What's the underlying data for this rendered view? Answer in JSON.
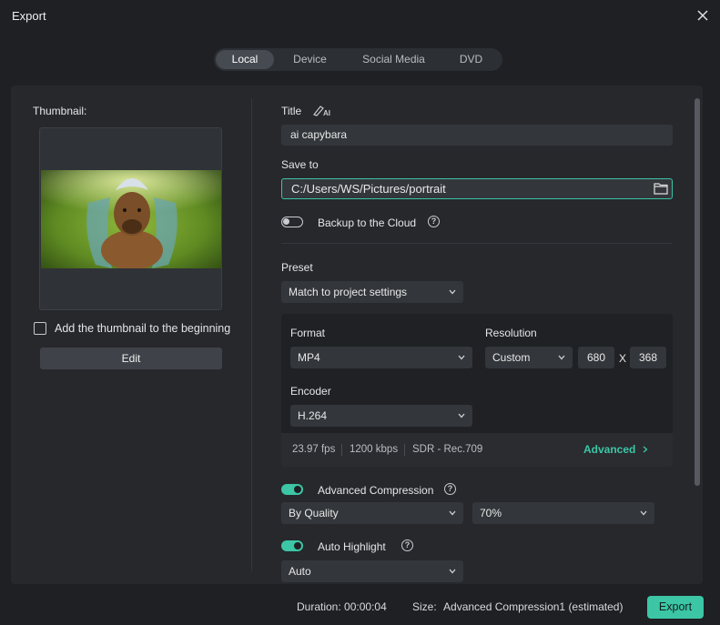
{
  "window": {
    "title": "Export"
  },
  "tabs": [
    {
      "label": "Local",
      "active": true
    },
    {
      "label": "Device",
      "active": false
    },
    {
      "label": "Social Media",
      "active": false
    },
    {
      "label": "DVD",
      "active": false
    }
  ],
  "thumbnail": {
    "label": "Thumbnail:",
    "add_to_beginning_label": "Add the thumbnail to the beginning",
    "add_to_beginning_checked": false,
    "edit_label": "Edit"
  },
  "form": {
    "title_label": "Title",
    "ai_icon": "ai-pen-icon",
    "title_value": "ai capybara",
    "save_to_label": "Save to",
    "save_to_value": "C:/Users/WS/Pictures/portrait",
    "backup_label": "Backup to the Cloud",
    "backup_enabled": false,
    "preset_label": "Preset",
    "preset_value": "Match to project settings"
  },
  "format_panel": {
    "format_label": "Format",
    "format_value": "MP4",
    "resolution_label": "Resolution",
    "resolution_value": "Custom",
    "width": "680",
    "x_label": "X",
    "height": "368",
    "encoder_label": "Encoder",
    "encoder_value": "H.264",
    "fps": "23.97 fps",
    "bitrate": "1200 kbps",
    "color": "SDR - Rec.709",
    "advanced_label": "Advanced"
  },
  "compression": {
    "label": "Advanced Compression",
    "enabled": true,
    "mode_value": "By Quality",
    "quality_value": "70%"
  },
  "highlight": {
    "label": "Auto Highlight",
    "enabled": true,
    "value_partial": "Auto"
  },
  "footer": {
    "duration_label": "Duration:",
    "duration_value": "00:00:04",
    "size_label": "Size:",
    "size_value": "Advanced Compression1 (estimated)",
    "export_label": "Export"
  },
  "colors": {
    "accent": "#3cc6a6",
    "background": "#1e2024",
    "panel": "#26282c"
  }
}
